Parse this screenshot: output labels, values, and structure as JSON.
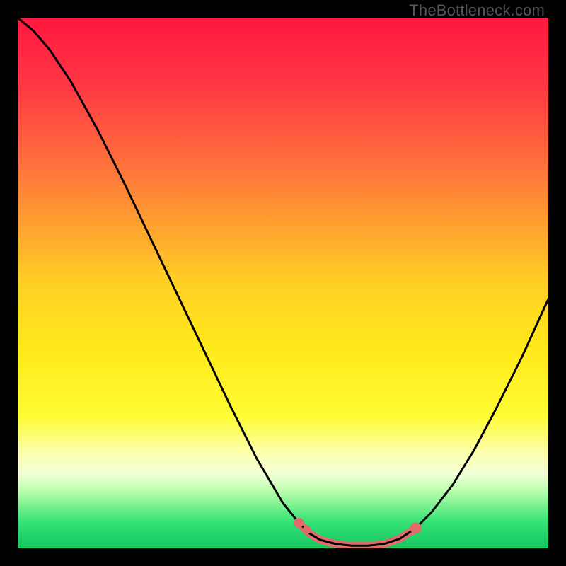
{
  "watermark": "TheBottleneck.com",
  "chart_data": {
    "type": "line",
    "title": "",
    "xlabel": "",
    "ylabel": "",
    "x_range": [
      0,
      100
    ],
    "y_range": [
      0,
      100
    ],
    "background_gradient": {
      "stops": [
        {
          "offset": 0,
          "color": "#ff173e"
        },
        {
          "offset": 12,
          "color": "#ff3545"
        },
        {
          "offset": 30,
          "color": "#ff7a3a"
        },
        {
          "offset": 50,
          "color": "#ffd024"
        },
        {
          "offset": 62,
          "color": "#ffe81a"
        },
        {
          "offset": 75,
          "color": "#fffc33"
        },
        {
          "offset": 82,
          "color": "#fdffad"
        },
        {
          "offset": 86,
          "color": "#f2ffd8"
        },
        {
          "offset": 89,
          "color": "#beffb0"
        },
        {
          "offset": 92,
          "color": "#7af18e"
        },
        {
          "offset": 95,
          "color": "#35e276"
        },
        {
          "offset": 100,
          "color": "#14c85f"
        }
      ]
    },
    "series": [
      {
        "name": "bottleneck-curve",
        "stroke": "#000000",
        "stroke_width": 3,
        "points": [
          {
            "x": 0,
            "y": 100
          },
          {
            "x": 3,
            "y": 97.5
          },
          {
            "x": 6,
            "y": 94
          },
          {
            "x": 10,
            "y": 88
          },
          {
            "x": 15,
            "y": 79
          },
          {
            "x": 20,
            "y": 69
          },
          {
            "x": 25,
            "y": 58.5
          },
          {
            "x": 30,
            "y": 48
          },
          {
            "x": 35,
            "y": 37.5
          },
          {
            "x": 40,
            "y": 27
          },
          {
            "x": 45,
            "y": 17
          },
          {
            "x": 50,
            "y": 8.5
          },
          {
            "x": 53,
            "y": 4.8
          },
          {
            "x": 55,
            "y": 2.8
          },
          {
            "x": 57,
            "y": 1.6
          },
          {
            "x": 60,
            "y": 0.8
          },
          {
            "x": 63,
            "y": 0.5
          },
          {
            "x": 66,
            "y": 0.5
          },
          {
            "x": 69,
            "y": 0.8
          },
          {
            "x": 72,
            "y": 1.8
          },
          {
            "x": 75,
            "y": 3.8
          },
          {
            "x": 78,
            "y": 6.8
          },
          {
            "x": 82,
            "y": 12
          },
          {
            "x": 86,
            "y": 18.5
          },
          {
            "x": 90,
            "y": 26
          },
          {
            "x": 95,
            "y": 36
          },
          {
            "x": 100,
            "y": 47
          }
        ]
      },
      {
        "name": "highlight-segment",
        "stroke": "#e16a6a",
        "stroke_width": 11,
        "points": [
          {
            "x": 53,
            "y": 4.8
          },
          {
            "x": 55,
            "y": 2.8
          },
          {
            "x": 57,
            "y": 1.6
          },
          {
            "x": 60,
            "y": 0.8
          },
          {
            "x": 63,
            "y": 0.5
          },
          {
            "x": 66,
            "y": 0.5
          },
          {
            "x": 69,
            "y": 0.8
          },
          {
            "x": 72,
            "y": 1.8
          },
          {
            "x": 75,
            "y": 3.8
          }
        ]
      }
    ],
    "markers": [
      {
        "x": 53,
        "y": 4.8,
        "r": 7,
        "color": "#e16a6a"
      },
      {
        "x": 54.5,
        "y": 3.5,
        "r": 6,
        "color": "#e16a6a"
      },
      {
        "x": 75,
        "y": 3.8,
        "r": 8,
        "color": "#e16a6a"
      }
    ]
  }
}
